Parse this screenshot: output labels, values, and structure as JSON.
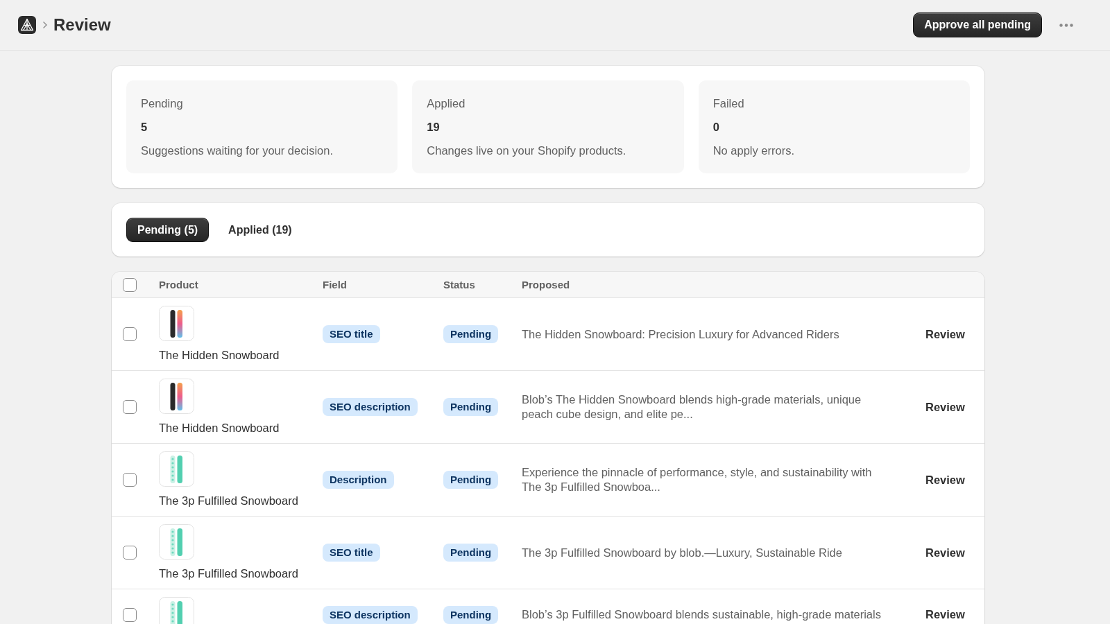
{
  "header": {
    "breadcrumb": "Review",
    "primary_action": "Approve all pending"
  },
  "stats": [
    {
      "label": "Pending",
      "value": "5",
      "description": "Suggestions waiting for your decision."
    },
    {
      "label": "Applied",
      "value": "19",
      "description": "Changes live on your Shopify products."
    },
    {
      "label": "Failed",
      "value": "0",
      "description": "No apply errors."
    }
  ],
  "tabs": [
    {
      "label": "Pending (5)",
      "selected": true
    },
    {
      "label": "Applied (19)",
      "selected": false
    }
  ],
  "table": {
    "select_all": {
      "checked": false
    },
    "columns": [
      "Product",
      "Field",
      "Status",
      "Proposed"
    ],
    "rows": [
      {
        "checked": false,
        "product": {
          "name": "The Hidden Snowboard",
          "image": {
            "kind": "gradient"
          }
        },
        "field": "SEO title",
        "status": "Pending",
        "proposed": "The Hidden Snowboard: Precision Luxury for Advanced Riders",
        "action": "Review"
      },
      {
        "checked": false,
        "product": {
          "name": "The Hidden Snowboard",
          "image": {
            "kind": "gradient"
          }
        },
        "field": "SEO description",
        "status": "Pending",
        "proposed": "Blob’s The Hidden Snowboard blends high-grade materials, unique peach cube design, and elite pe...",
        "action": "Review"
      },
      {
        "checked": false,
        "product": {
          "name": "The 3p Fulfilled Snowboard",
          "image": {
            "kind": "mint"
          }
        },
        "field": "Description",
        "status": "Pending",
        "proposed": "Experience the pinnacle of performance, style, and sustainability with The 3p Fulfilled Snowboa...",
        "action": "Review"
      },
      {
        "checked": false,
        "product": {
          "name": "The 3p Fulfilled Snowboard",
          "image": {
            "kind": "mint"
          }
        },
        "field": "SEO title",
        "status": "Pending",
        "proposed": "The 3p Fulfilled Snowboard by blob.—Luxury, Sustainable Ride",
        "action": "Review"
      },
      {
        "checked": false,
        "product": {
          "image": {
            "kind": "mint"
          }
        },
        "field": "SEO description",
        "status": "Pending",
        "proposed": "Blob’s 3p Fulfilled Snowboard blends sustainable, high-grade materials",
        "action": "Review"
      }
    ]
  }
}
